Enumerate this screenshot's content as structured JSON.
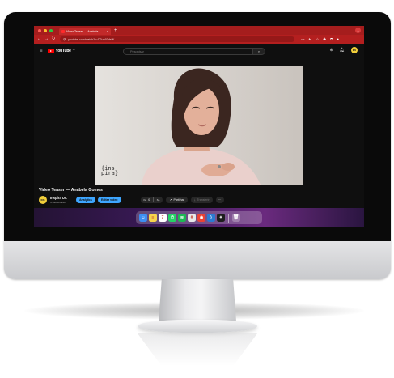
{
  "browser": {
    "tab_title": "Video Teaser — Anabela",
    "tab_close": "×",
    "new_tab": "+",
    "url": "youtube.com/watch?v=D3ue93rfeW",
    "dot_colors": [
      "#ff5f57",
      "#febc2e",
      "#28c840"
    ]
  },
  "youtube": {
    "logo_word": "YouTube",
    "country": "PT",
    "search_placeholder": "Pesquisar",
    "avatar_initials": "INS"
  },
  "video": {
    "title": "Video Teaser — Anabela Gomes",
    "watermark_line1": "{ins",
    "watermark_line2": "pira}"
  },
  "channel": {
    "name": "Inspira UC",
    "subscribers": "4 subscritores",
    "avatar_initials": "INS",
    "analytics_label": "Analytics",
    "edit_label": "Editar vídeo"
  },
  "actions": {
    "like_count": "0",
    "share_label": "Partilhar",
    "download_label": "Transferir",
    "more": "···"
  },
  "dock": {
    "apps": [
      {
        "name": "finder",
        "glyph": "☺",
        "color": "#3d8ef1"
      },
      {
        "name": "notes",
        "glyph": "≡",
        "color": "#f7d44c"
      },
      {
        "name": "calendar",
        "glyph": "7",
        "color": "#ffffff"
      },
      {
        "name": "whatsapp",
        "glyph": "✆",
        "color": "#25d366"
      },
      {
        "name": "spotify",
        "glyph": "≋",
        "color": "#1db954"
      },
      {
        "name": "slack",
        "glyph": "#",
        "color": "#e8e8e8"
      },
      {
        "name": "chrome",
        "glyph": "◉",
        "color": "#ea4335"
      },
      {
        "name": "vscode",
        "glyph": "⟩",
        "color": "#2b7bd2"
      },
      {
        "name": "figma",
        "glyph": "✦",
        "color": "#1e1e1e"
      }
    ],
    "trash_glyph": "🗑"
  }
}
